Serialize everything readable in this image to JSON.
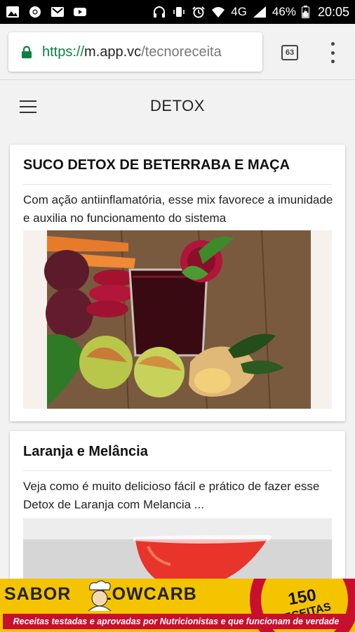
{
  "status_bar": {
    "signal_label": "4G",
    "battery": "46%",
    "time": "20:05"
  },
  "browser": {
    "url_scheme": "https://",
    "url_host": "m.app.vc",
    "url_path": "/tecnoreceita",
    "tab_count": "63"
  },
  "header": {
    "title": "DETOX"
  },
  "posts": [
    {
      "title": "SUCO DETOX DE BETERRABA E MAÇA",
      "description": "Com ação antiinflamatória, esse mix favorece a imunidade e auxilia no funcionamento do sistema"
    },
    {
      "title": "Laranja e Melância",
      "description": "Veja como é muito delicioso fácil e prático de fazer esse Detox de Laranja com Melancia ..."
    }
  ],
  "ad": {
    "brand_left": "SABOR",
    "brand_right": "LOWCARB",
    "badge_number": "150",
    "badge_label": "RECEITAS",
    "tagline": "Receitas testadas e aprovadas por Nutricionistas e que funcionam de verdade"
  }
}
